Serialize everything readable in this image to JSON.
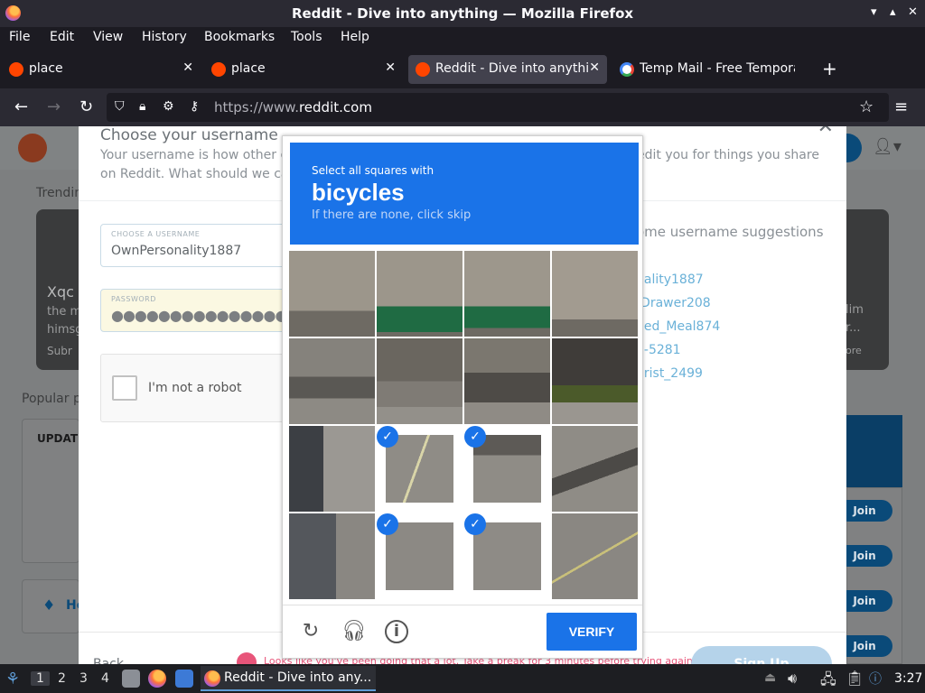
{
  "window": {
    "title": "Reddit - Dive into anything — Mozilla Firefox"
  },
  "menu": [
    "File",
    "Edit",
    "View",
    "History",
    "Bookmarks",
    "Tools",
    "Help"
  ],
  "tabs": [
    {
      "label": "place",
      "icon": "reddit-icon",
      "active": false
    },
    {
      "label": "place",
      "icon": "reddit-icon",
      "active": false
    },
    {
      "label": "Reddit - Dive into anythin",
      "icon": "reddit-icon",
      "active": true
    },
    {
      "label": "Temp Mail - Free Tempora",
      "icon": "google-icon",
      "active": false
    }
  ],
  "url": {
    "prefix": "https://www.",
    "domain": "reddit.com"
  },
  "background": {
    "trending": "Trendin",
    "card_title": "Xqc",
    "card_line1": "the m",
    "card_line2": "himsg",
    "card_sub": "Subr",
    "right_line1": "lim",
    "right_line2": "r...",
    "right_line3": "ore",
    "popular": "Popular p",
    "update": "UPDATE",
    "home": "He",
    "join_labels": [
      "Join",
      "Join",
      "Join",
      "Join"
    ]
  },
  "modal": {
    "title": "Choose your username",
    "description_left": "Your username is how other co",
    "description_right": "edit you for things you share",
    "description_line2": "on Reddit. What should we call",
    "username_label": "CHOOSE A USERNAME",
    "username_value": "OwnPersonality1887",
    "password_label": "PASSWORD",
    "password_value": "●●●●●●●●●●●●●●●",
    "recaptcha_label": "I'm not a robot",
    "suggestions_title": "ome username suggestions",
    "suggestions": [
      "nality1887",
      "-Drawer208",
      "ded_Meal874",
      "d-5281",
      "urist_2499"
    ],
    "back": "Back",
    "warning": "Looks like you've been doing that a lot. Take a break for 3 minutes before trying again.",
    "signup": "Sign Up"
  },
  "captcha": {
    "instruction": "Select all squares with",
    "target": "bicycles",
    "hint": "If there are none, click skip",
    "selected_tiles": [
      9,
      10,
      13,
      14
    ],
    "verify": "VERIFY",
    "icons": [
      "reload-icon",
      "audio-icon",
      "info-icon"
    ]
  },
  "taskbar": {
    "workspaces": [
      "1",
      "2",
      "3",
      "4"
    ],
    "active_workspace": "1",
    "app_label": "Reddit - Dive into any...",
    "clock": "3:27"
  }
}
